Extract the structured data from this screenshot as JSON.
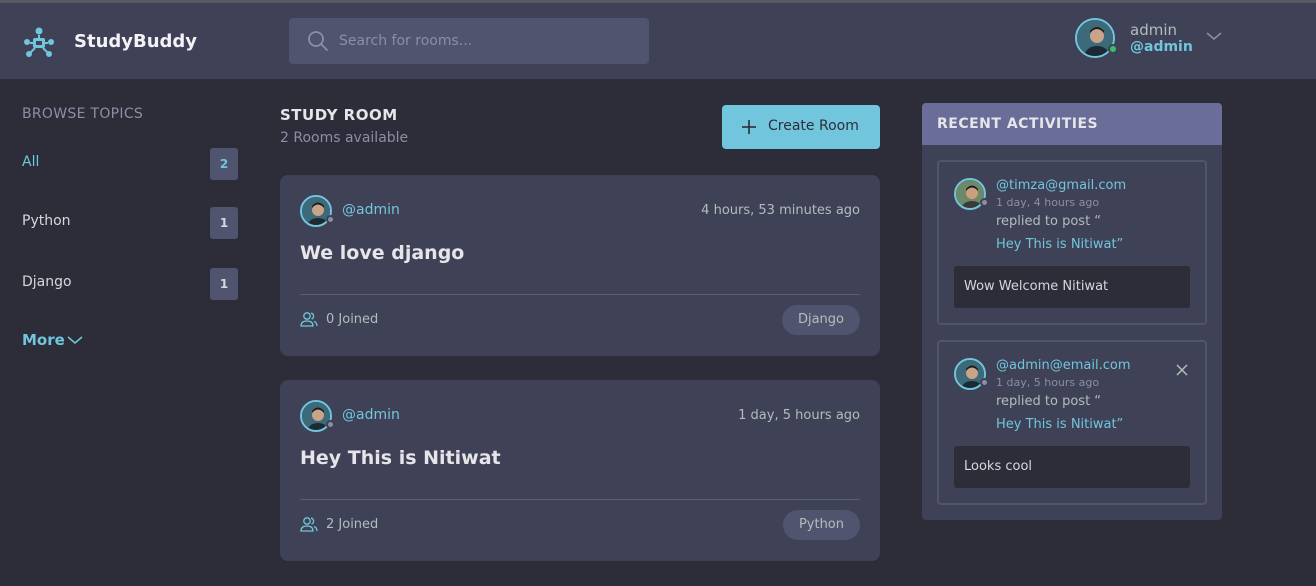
{
  "app": {
    "brand": "StudyBuddy"
  },
  "search": {
    "placeholder": "Search for rooms..."
  },
  "user": {
    "name": "admin",
    "handle": "@admin"
  },
  "sidebar": {
    "title": "BROWSE TOPICS",
    "topics": [
      {
        "label": "All",
        "count": "2"
      },
      {
        "label": "Python",
        "count": "1"
      },
      {
        "label": "Django",
        "count": "1"
      }
    ],
    "more_label": "More"
  },
  "main": {
    "title": "STUDY ROOM",
    "subtitle": "2 Rooms available",
    "create_label": "Create Room",
    "rooms": [
      {
        "host": "@admin",
        "time": "4 hours, 53 minutes ago",
        "name": "We love django",
        "joined": "0 Joined",
        "topic": "Django"
      },
      {
        "host": "@admin",
        "time": "1 day, 5 hours ago",
        "name": "Hey This is Nitiwat",
        "joined": "2 Joined",
        "topic": "Python"
      }
    ]
  },
  "activities": {
    "title": "RECENT ACTIVITIES",
    "items": [
      {
        "user": "@timza@gmail.com",
        "when": "1 day, 4 hours ago",
        "action": "replied to post “",
        "post": "Hey This is Nitiwat”",
        "message": "Wow Welcome Nitiwat"
      },
      {
        "user": "@admin@email.com",
        "when": "1 day, 5 hours ago",
        "action": "replied to post “",
        "post": "Hey This is Nitiwat”",
        "message": "Looks cool"
      }
    ]
  },
  "colors": {
    "accent": "#71c6dd",
    "background": "#2d2d39",
    "panel": "#3f4156",
    "activities_header": "#696d97"
  }
}
